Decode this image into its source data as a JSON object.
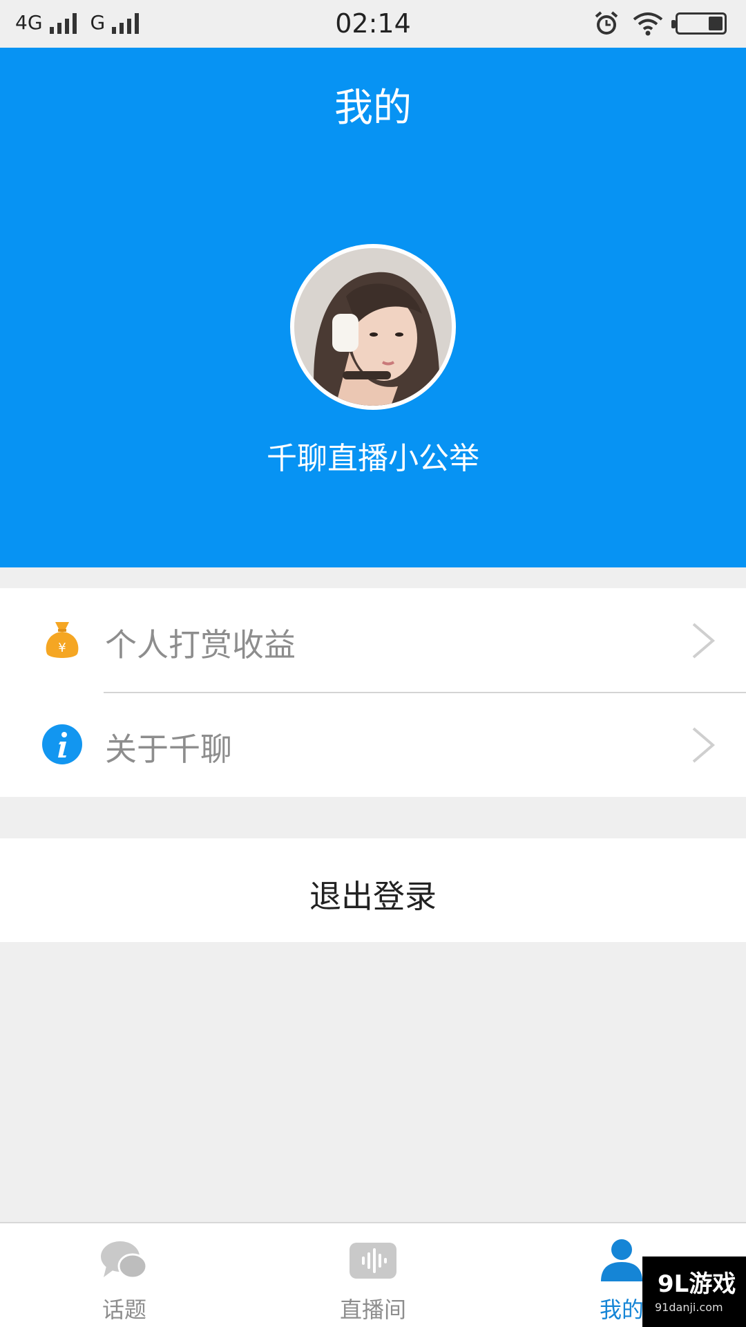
{
  "status_bar": {
    "network_1": "4G",
    "network_2": "G",
    "time": "02:14",
    "icons": [
      "signal-bars-icon",
      "alarm-clock-icon",
      "wifi-icon",
      "battery-icon"
    ],
    "battery_level": 0.3
  },
  "header": {
    "title": "我的",
    "username": "千聊直播小公举",
    "background_color": "#0793f3"
  },
  "menu": {
    "items": [
      {
        "label": "个人打赏收益",
        "icon": "money-bag-icon"
      },
      {
        "label": "关于千聊",
        "icon": "info-icon"
      }
    ]
  },
  "logout": {
    "label": "退出登录"
  },
  "tabbar": {
    "tabs": [
      {
        "label": "话题",
        "icon": "chat-bubbles-icon",
        "active": false
      },
      {
        "label": "直播间",
        "icon": "audio-waveform-icon",
        "active": false
      },
      {
        "label": "我的",
        "icon": "person-icon",
        "active": true
      }
    ],
    "active_color": "#1585d6"
  },
  "watermark": {
    "logo": "9L游戏",
    "url": "91danji.com"
  }
}
